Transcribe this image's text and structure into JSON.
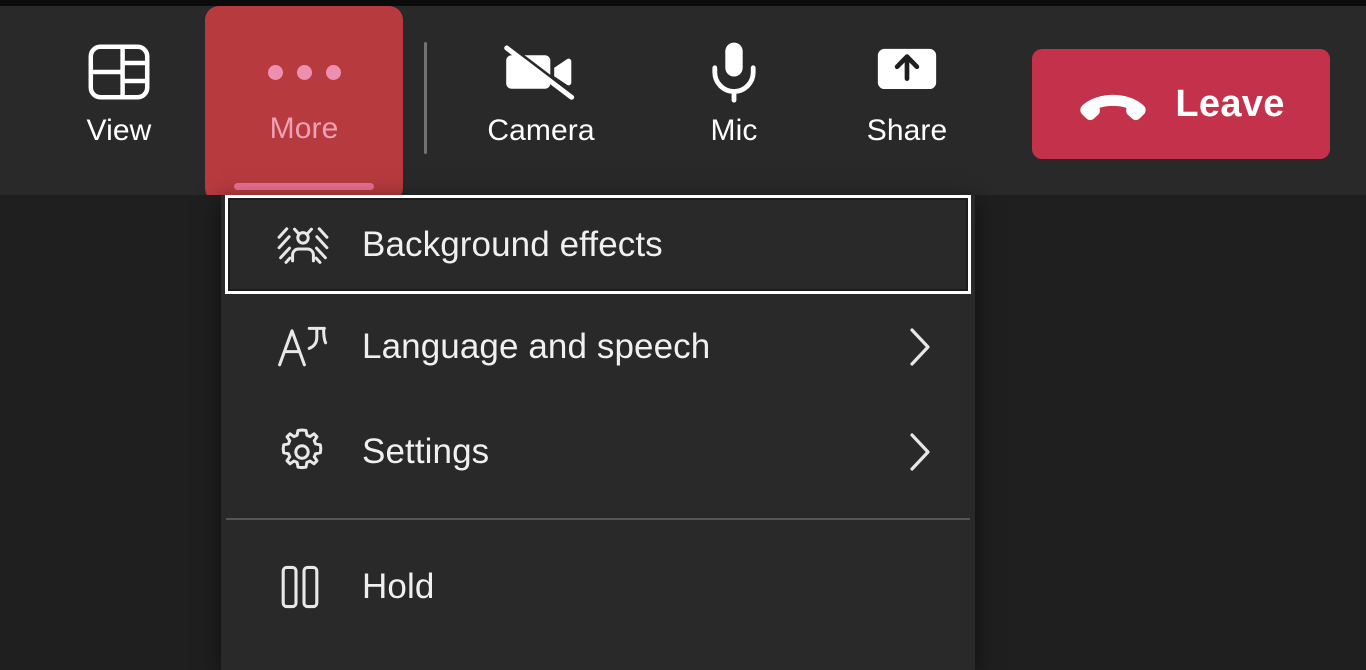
{
  "toolbar": {
    "buttons": [
      {
        "id": "view",
        "label": "View",
        "icon": "gallery-layout-icon",
        "state": "default"
      },
      {
        "id": "more",
        "label": "More",
        "icon": "more-horizontal-icon",
        "state": "active"
      },
      {
        "id": "camera",
        "label": "Camera",
        "icon": "camera-off-icon",
        "state": "off"
      },
      {
        "id": "mic",
        "label": "Mic",
        "icon": "microphone-icon",
        "state": "on"
      },
      {
        "id": "share",
        "label": "Share",
        "icon": "share-screen-icon",
        "state": "default"
      }
    ],
    "leave_button": {
      "label": "Leave",
      "icon": "hangup-phone-icon"
    }
  },
  "menu": {
    "items": [
      {
        "id": "background-effects",
        "label": "Background effects",
        "icon": "background-effects-icon",
        "has_submenu": false,
        "focused": true
      },
      {
        "id": "language-and-speech",
        "label": "Language and speech",
        "icon": "translate-icon",
        "has_submenu": true,
        "focused": false
      },
      {
        "id": "settings",
        "label": "Settings",
        "icon": "gear-icon",
        "has_submenu": true,
        "focused": false
      },
      {
        "id": "hold",
        "label": "Hold",
        "icon": "pause-icon",
        "has_submenu": false,
        "focused": false
      }
    ]
  },
  "colors": {
    "toolbar_bg": "#292929",
    "stage_bg": "#1f1f1f",
    "menu_bg": "#292929",
    "leave_red": "#c4314b",
    "more_active_red": "#b73a3e",
    "more_accent_pink": "#e86f92",
    "focus_ring": "#ffffff",
    "text_primary": "#ffffff",
    "divider": "#565656"
  }
}
